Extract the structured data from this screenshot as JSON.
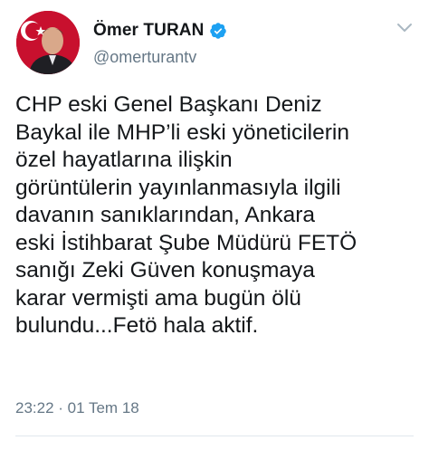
{
  "user": {
    "display_name": "Ömer TURAN",
    "handle": "@omerturantv",
    "verified": true
  },
  "tweet": {
    "text": "CHP eski Genel Başkanı Deniz\nBaykal ile MHP’li eski yöneticilerin\nözel hayatlarına ilişkin\ngörüntülerin yayınlanmasıyla ilgili\ndavanın sanıklarından, Ankara\neski İstihbarat Şube Müdürü FETÖ\nsanığı Zeki Güven konuşmaya\nkarar vermişti ama bugün ölü\nbulundu...Fetö hala aktif.",
    "timestamp": "23:22 · 01 Tem 18"
  },
  "icons": {
    "verified": "verified-badge-icon",
    "menu": "chevron-down-icon"
  },
  "colors": {
    "verified_blue": "#1da1f2",
    "secondary_text": "#657786",
    "primary_text": "#14171a"
  }
}
